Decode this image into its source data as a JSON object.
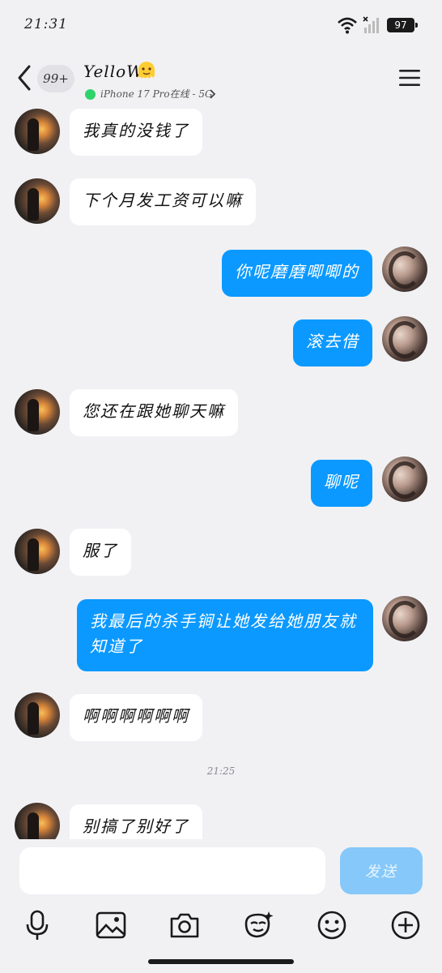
{
  "status_bar": {
    "time": "21:31",
    "battery": "97"
  },
  "header": {
    "back_badge": "99+",
    "contact_name": "YelloW",
    "status_text": "iPhone 17 Pro在线 - 5G",
    "emoji": "melting-face-emoji"
  },
  "messages": [
    {
      "side": "in",
      "text": "我真的没钱了"
    },
    {
      "side": "in",
      "text": "下个月发工资可以嘛"
    },
    {
      "side": "out",
      "text": "你呢磨磨唧唧的"
    },
    {
      "side": "out",
      "text": "滚去借"
    },
    {
      "side": "in",
      "text": "您还在跟她聊天嘛"
    },
    {
      "side": "out",
      "text": "聊呢"
    },
    {
      "side": "in",
      "text": "服了"
    },
    {
      "side": "out",
      "text": "我最后的杀手锏让她发给她朋友就知道了"
    },
    {
      "side": "in",
      "text": "啊啊啊啊啊啊"
    },
    {
      "side": "in",
      "text": "别搞了别好了"
    }
  ],
  "time_divider": "21:25",
  "input": {
    "placeholder": "",
    "send_label": "发送"
  },
  "toolbar": [
    "microphone-icon",
    "image-icon",
    "camera-icon",
    "sticker-icon",
    "emoji-icon",
    "add-icon"
  ],
  "colors": {
    "outgoing_bubble": "#0b99ff",
    "send_button": "#86c8f9",
    "online": "#2fd36b"
  }
}
